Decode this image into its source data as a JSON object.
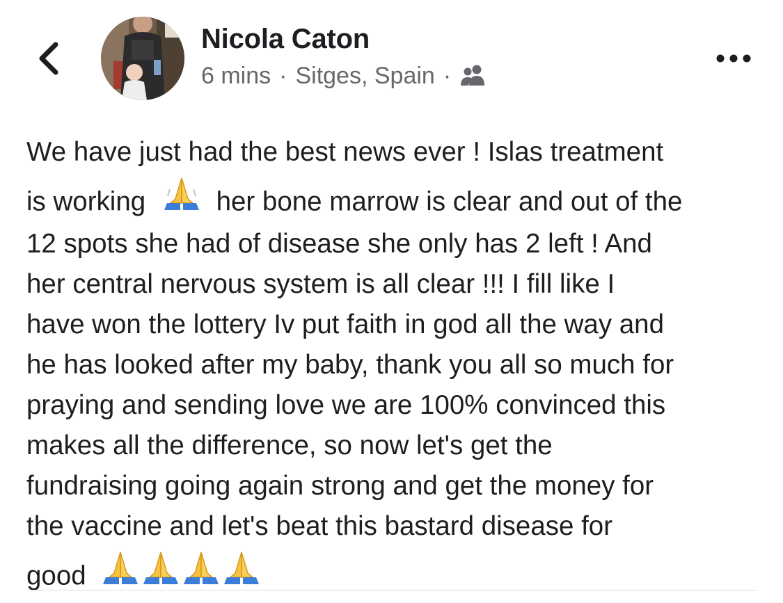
{
  "post": {
    "author": "Nicola Caton",
    "time": "6 mins",
    "separator": "·",
    "location": "Sitges, Spain",
    "audience_icon": "friends-icon",
    "more_icon": "more-horizontal-icon",
    "back_icon": "chevron-left-icon",
    "body_lines": [
      "We have just had the best news ever ! Islas treatment",
      "is working",
      "her bone marrow is clear and out of the",
      "12 spots she had of disease she only has 2 left ! And",
      "her central nervous system is all clear !!! I fill like I",
      "have won the lottery Iv put faith in god all the way and",
      "he has looked after my baby, thank you all so much for",
      "praying and sending love we are 100% convinced this",
      "makes all the difference, so now let's get the",
      "fundraising going again strong and get the money for",
      "the vaccine and let's beat this bastard disease for",
      "good"
    ],
    "emoji": "folded-hands-emoji"
  },
  "colors": {
    "text": "#1c1e21",
    "meta": "#65676b",
    "emoji_hands": "#f6c343",
    "emoji_sleeve": "#3b7dd8"
  }
}
